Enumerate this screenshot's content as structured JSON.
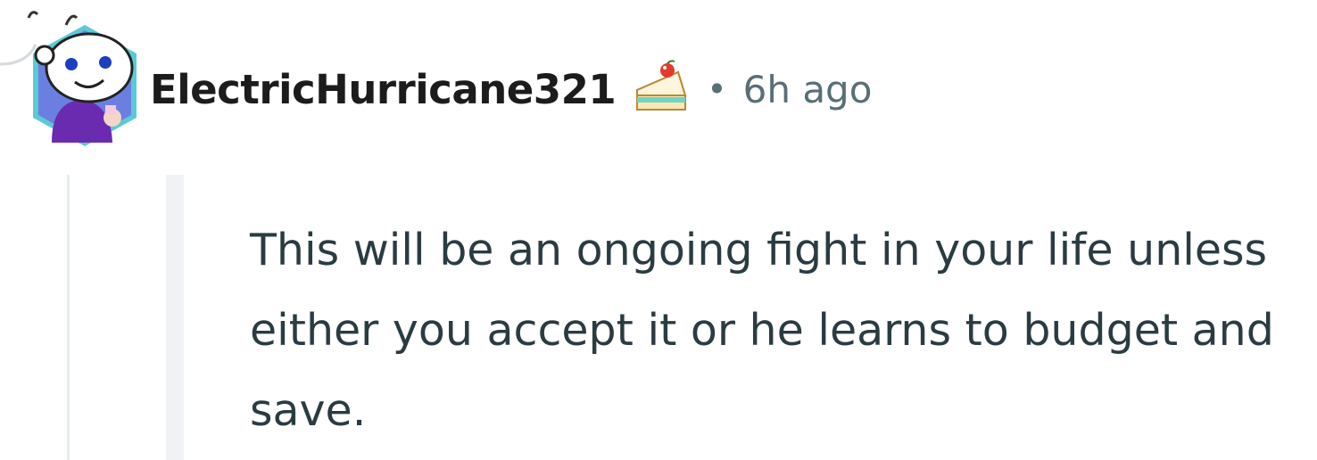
{
  "comment": {
    "username": "ElectricHurricane321",
    "separator": "•",
    "timestamp": "6h ago",
    "body": "This will be an ongoing fight in your life unless either you accept it or he learns to budget and save."
  },
  "icons": {
    "avatar": "snoo-avatar-icon",
    "badge": "cake-day-icon"
  },
  "colors": {
    "username": "#1c1c1c",
    "meta": "#576f76",
    "body_text": "#2a3c42",
    "avatar_border": "#5cc9d6",
    "avatar_bg": "#6b7fe0",
    "thread_rail": "#e5ebee"
  }
}
